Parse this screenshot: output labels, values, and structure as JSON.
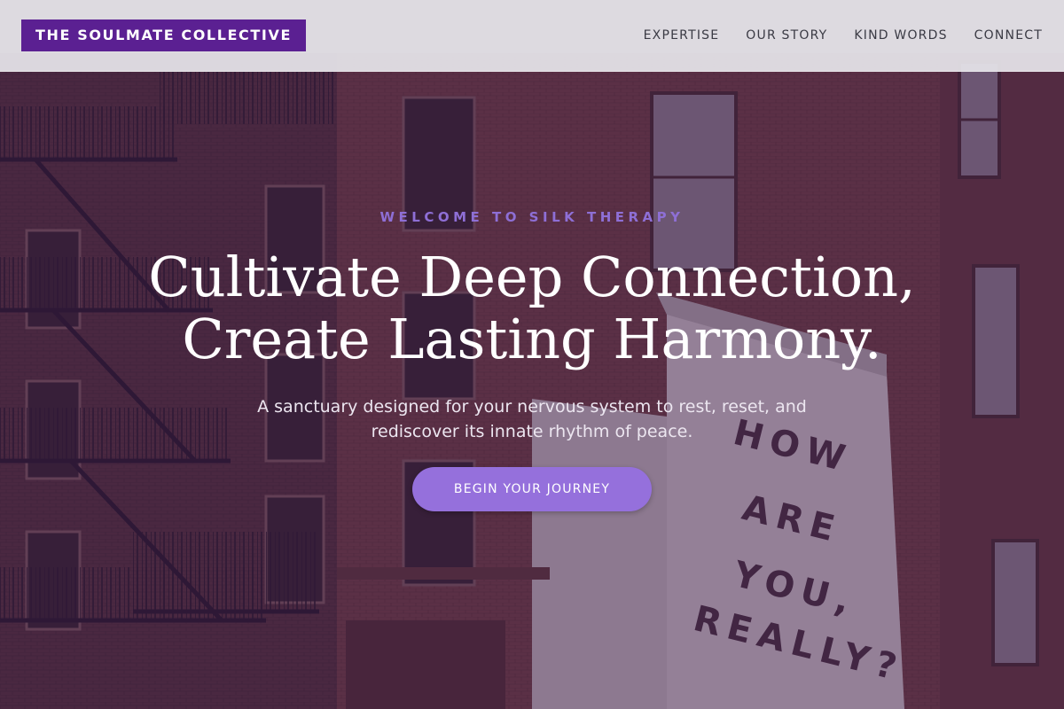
{
  "header": {
    "brand": "THE SOULMATE COLLECTIVE",
    "nav": [
      "EXPERTISE",
      "OUR STORY",
      "KIND WORDS",
      "CONNECT"
    ]
  },
  "hero": {
    "eyebrow": "WELCOME TO SILK THERAPY",
    "headline_line1": "Cultivate Deep Connection,",
    "headline_line2": "Create Lasting Harmony.",
    "subtitle": "A sanctuary designed for your nervous system to rest, reset, and rediscover its innate rhythm of peace.",
    "cta_label": "BEGIN YOUR JOURNEY",
    "banner_words": [
      "HOW",
      "ARE",
      "YOU,",
      "REALLY?"
    ]
  },
  "colors": {
    "brand": "#5b2092",
    "accent": "#9570dc",
    "eyebrow": "#8e6fd6",
    "overlay": "#462050",
    "header_bg": "#e4e2e8"
  }
}
